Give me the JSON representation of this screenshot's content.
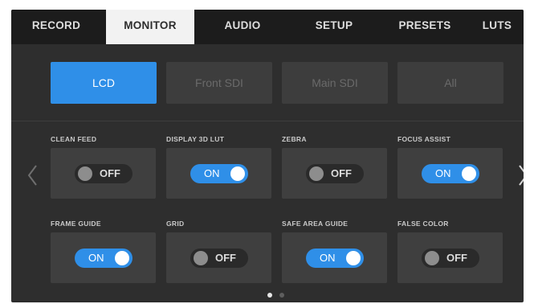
{
  "tabs": [
    {
      "label": "RECORD"
    },
    {
      "label": "MONITOR"
    },
    {
      "label": "AUDIO"
    },
    {
      "label": "SETUP"
    },
    {
      "label": "PRESETS"
    },
    {
      "label": "LUTS"
    }
  ],
  "active_tab": "MONITOR",
  "outputs": [
    {
      "label": "LCD"
    },
    {
      "label": "Front SDI"
    },
    {
      "label": "Main SDI"
    },
    {
      "label": "All"
    }
  ],
  "active_output": "LCD",
  "settings": [
    {
      "label": "CLEAN FEED",
      "state": "OFF"
    },
    {
      "label": "DISPLAY 3D LUT",
      "state": "ON"
    },
    {
      "label": "ZEBRA",
      "state": "OFF"
    },
    {
      "label": "FOCUS ASSIST",
      "state": "ON"
    },
    {
      "label": "FRAME GUIDE",
      "state": "ON"
    },
    {
      "label": "GRID",
      "state": "OFF"
    },
    {
      "label": "SAFE AREA GUIDE",
      "state": "ON"
    },
    {
      "label": "FALSE COLOR",
      "state": "OFF"
    }
  ],
  "pagination": {
    "current_page": 1,
    "total_pages": 2
  },
  "colors": {
    "accent": "#2f8fe8",
    "panel": "#2e2e2e",
    "tile": "#3f3f3f",
    "tab_bar": "#1c1c1c"
  },
  "icons": {
    "prev": "chevron-left-icon",
    "next": "chevron-right-icon"
  }
}
